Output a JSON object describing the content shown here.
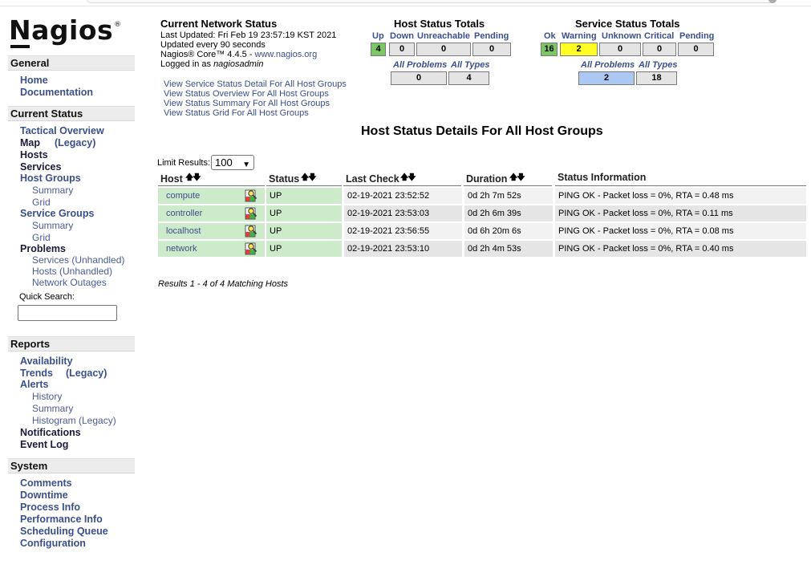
{
  "sidebar": {
    "logo": "Nagios",
    "general": {
      "title": "General",
      "items": [
        "Home",
        "Documentation"
      ]
    },
    "current_status": {
      "title": "Current Status",
      "tactical": "Tactical Overview",
      "map": "Map",
      "map_legacy": "(Legacy)",
      "hosts": "Hosts",
      "services": "Services",
      "host_groups": "Host Groups",
      "hg_summary": "Summary",
      "hg_grid": "Grid",
      "service_groups": "Service Groups",
      "sg_summary": "Summary",
      "sg_grid": "Grid",
      "problems": "Problems",
      "prob_services": "Services (Unhandled)",
      "prob_hosts": "Hosts (Unhandled)",
      "prob_outages": "Network Outages",
      "quick_search": "Quick Search:"
    },
    "reports": {
      "title": "Reports",
      "availability": "Availability",
      "trends": "Trends",
      "trends_legacy": "(Legacy)",
      "alerts": "Alerts",
      "history": "History",
      "summary": "Summary",
      "histogram": "Histogram (Legacy)",
      "notifications": "Notifications",
      "event_log": "Event Log"
    },
    "system": {
      "title": "System",
      "items": [
        "Comments",
        "Downtime",
        "Process Info",
        "Performance Info",
        "Scheduling Queue",
        "Configuration"
      ]
    }
  },
  "status": {
    "title": "Current Network Status",
    "last_updated": "Last Updated: Fri Feb 19 23:57:19 KST 2021",
    "update_every": "Updated every 90 seconds",
    "core": "Nagios® Core™ 4.4.5 - ",
    "core_link": "www.nagios.org",
    "logged_in_prefix": "Logged in as ",
    "user": "nagiosadmin",
    "links": [
      "View Service Status Detail For All Host Groups",
      "View Status Overview For All Host Groups",
      "View Status Summary For All Host Groups",
      "View Status Grid For All Host Groups"
    ]
  },
  "host_totals": {
    "title": "Host Status Totals",
    "labels": {
      "up": "Up",
      "down": "Down",
      "unreachable": "Unreachable",
      "pending": "Pending"
    },
    "values": {
      "up": "4",
      "down": "0",
      "unreachable": "0",
      "pending": "0"
    },
    "all_problems_label": "All Problems",
    "all_types_label": "All Types",
    "all_problems": "0",
    "all_types": "4"
  },
  "service_totals": {
    "title": "Service Status Totals",
    "labels": {
      "ok": "Ok",
      "warning": "Warning",
      "unknown": "Unknown",
      "critical": "Critical",
      "pending": "Pending"
    },
    "values": {
      "ok": "16",
      "warning": "2",
      "unknown": "0",
      "critical": "0",
      "pending": "0"
    },
    "all_problems_label": "All Problems",
    "all_types_label": "All Types",
    "all_problems": "2",
    "all_types": "18"
  },
  "main": {
    "title": "Host Status Details For All Host Groups",
    "limit_label": "Limit Results:",
    "limit_value": "100",
    "columns": {
      "host": "Host",
      "status": "Status",
      "last_check": "Last Check",
      "duration": "Duration",
      "info": "Status Information"
    },
    "rows": [
      {
        "host": "compute",
        "status": "UP",
        "last_check": "02-19-2021 23:52:52",
        "duration": "0d 2h 7m 52s",
        "info": "PING OK - Packet loss = 0%, RTA = 0.48 ms"
      },
      {
        "host": "controller",
        "status": "UP",
        "last_check": "02-19-2021 23:53:03",
        "duration": "0d 2h 6m 39s",
        "info": "PING OK - Packet loss = 0%, RTA = 0.11 ms"
      },
      {
        "host": "localhost",
        "status": "UP",
        "last_check": "02-19-2021 23:56:55",
        "duration": "0d 6h 20m 6s",
        "info": "PING OK - Packet loss = 0%, RTA = 0.08 ms"
      },
      {
        "host": "network",
        "status": "UP",
        "last_check": "02-19-2021 23:53:10",
        "duration": "0d 2h 4m 53s",
        "info": "PING OK - Packet loss = 0%, RTA = 0.40 ms"
      }
    ],
    "results": "Results 1 - 4 of 4 Matching Hosts"
  },
  "colors": {
    "up_green": "#7cc765",
    "row_green": "#cdeacb",
    "warning_yellow": "#ffff26",
    "problem_blue": "#abc8f2",
    "link_blue": "#3b4f8c"
  }
}
